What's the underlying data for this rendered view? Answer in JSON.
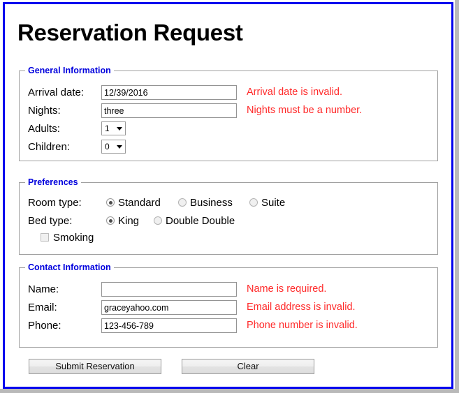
{
  "page": {
    "title": "Reservation Request",
    "frame_color": "#0000ee",
    "legend_color": "#0000dd",
    "error_color": "#ff2a2a"
  },
  "general": {
    "legend": "General Information",
    "rows": [
      {
        "label": "Arrival date:",
        "value": "12/39/2016",
        "error": "Arrival date is invalid."
      },
      {
        "label": "Nights:",
        "value": "three",
        "error": "Nights must be a number."
      },
      {
        "label": "Adults:",
        "value": "1",
        "error": ""
      },
      {
        "label": "Children:",
        "value": "0",
        "error": ""
      }
    ]
  },
  "preferences": {
    "legend": "Preferences",
    "room_type": {
      "label": "Room type:",
      "options": [
        {
          "label": "Standard",
          "selected": true
        },
        {
          "label": "Business",
          "selected": false
        },
        {
          "label": "Suite",
          "selected": false
        }
      ]
    },
    "bed_type": {
      "label": "Bed type:",
      "options": [
        {
          "label": "King",
          "selected": true
        },
        {
          "label": "Double Double",
          "selected": false
        }
      ]
    },
    "smoking": {
      "label": "Smoking",
      "checked": false
    }
  },
  "contact": {
    "legend": "Contact Information",
    "rows": [
      {
        "label": "Name:",
        "value": "",
        "error": "Name is required."
      },
      {
        "label": "Email:",
        "value": "graceyahoo.com",
        "error": "Email address is invalid."
      },
      {
        "label": "Phone:",
        "value": "123-456-789",
        "error": "Phone number is invalid."
      }
    ]
  },
  "actions": {
    "submit_label": "Submit Reservation",
    "clear_label": "Clear"
  }
}
